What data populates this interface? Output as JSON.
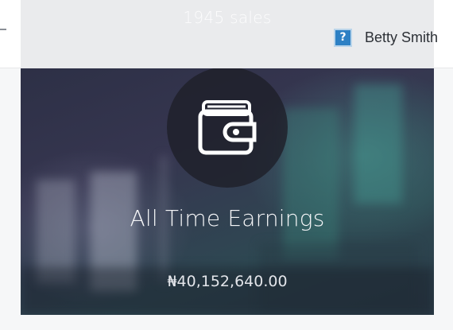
{
  "header": {
    "sales_text": "1945 sales",
    "user": {
      "help_icon_glyph": "?",
      "help_icon": "help-icon",
      "name": "Betty Smith"
    }
  },
  "earnings_card": {
    "icon": "wallet-icon",
    "title": "All Time Earnings",
    "amount": "₦40,152,640.00"
  },
  "colors": {
    "help_icon_bg": "#2d80c4",
    "card_overlay": "#2d3046",
    "page_bg": "#f6f7f8"
  }
}
